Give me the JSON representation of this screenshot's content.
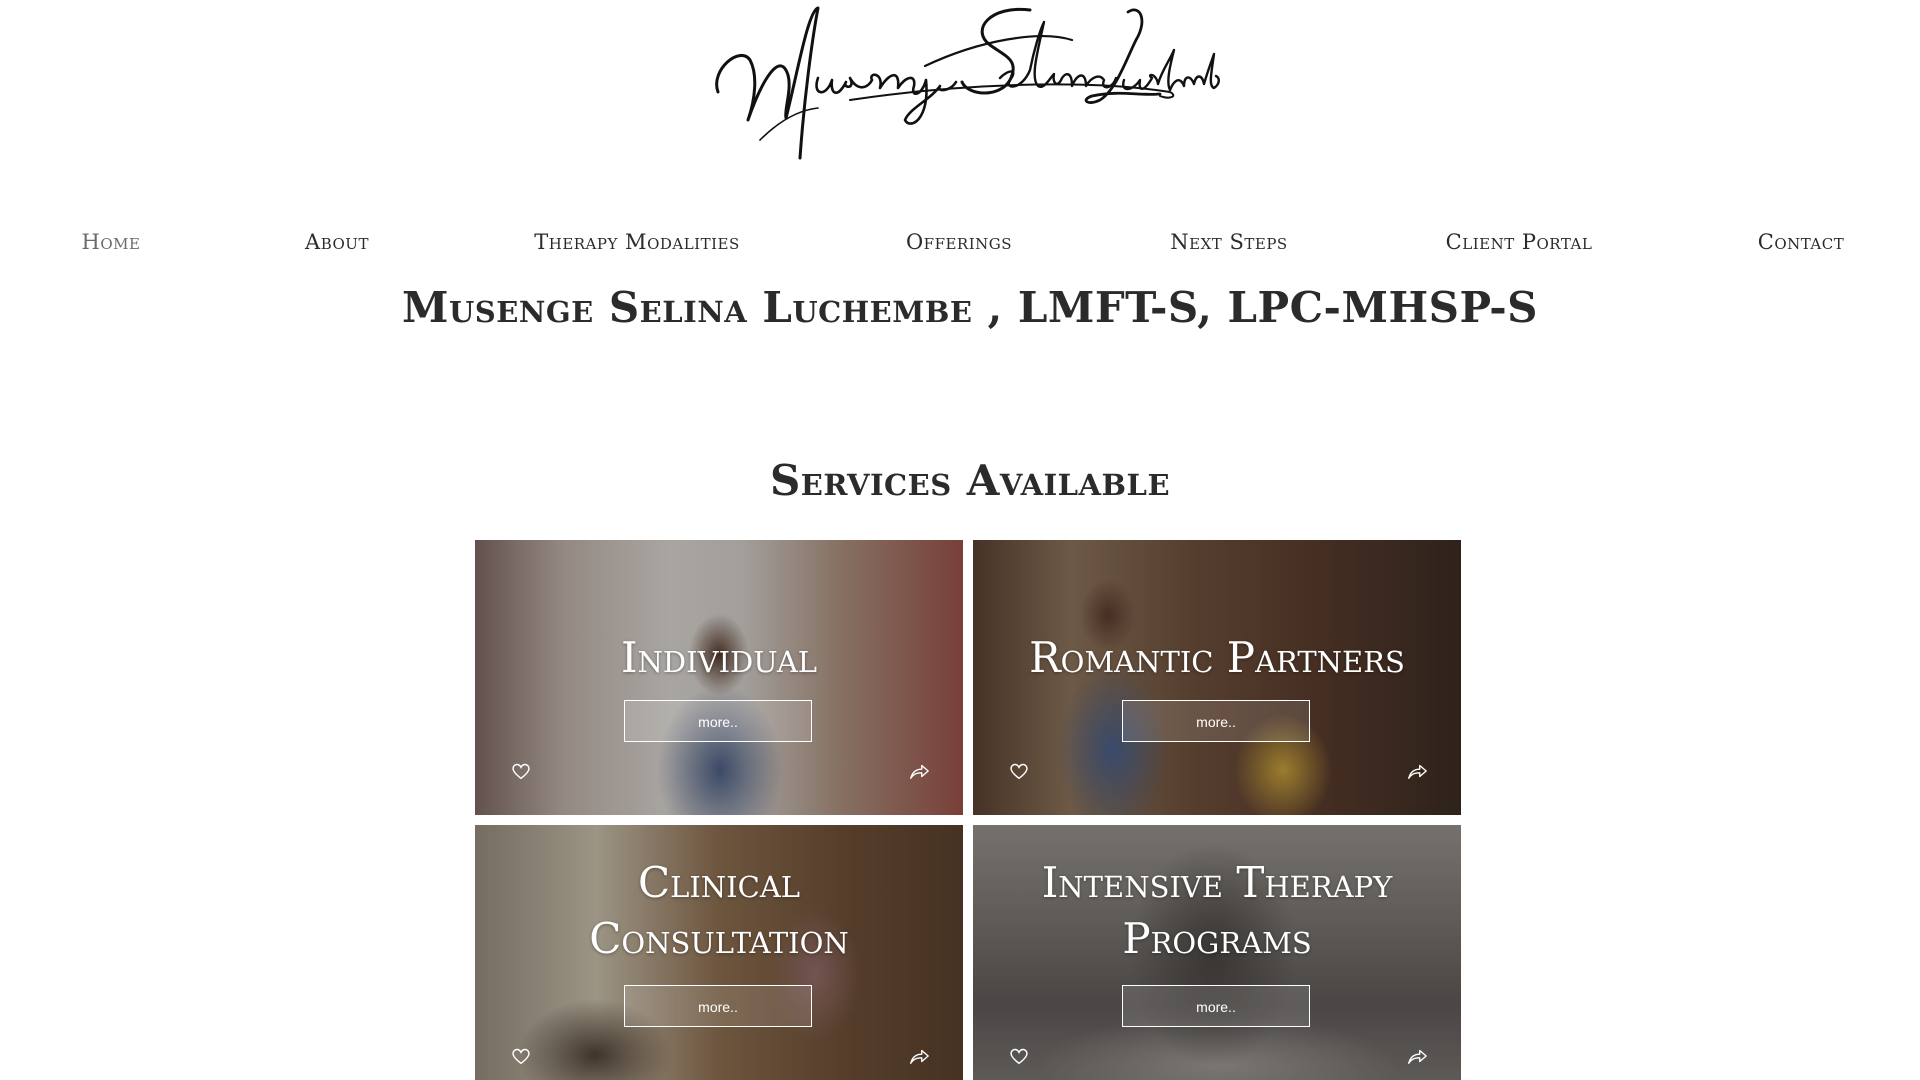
{
  "logo": {
    "signature_text": "Musenge Selina Luchembe"
  },
  "nav": {
    "items": [
      {
        "label": "Home"
      },
      {
        "label": "About"
      },
      {
        "label": "Therapy Modalities"
      },
      {
        "label": "Offerings"
      },
      {
        "label": "Next Steps"
      },
      {
        "label": "Client Portal"
      },
      {
        "label": "Contact"
      }
    ],
    "active_color": "#6b6b6b"
  },
  "page_title": "Musenge Selina Luchembe , LMFT-S, LPC-MHSP-S",
  "services": {
    "title": "Services Available",
    "cards": [
      {
        "title_line1": "Individual",
        "title_line2": "",
        "button": "more..",
        "like_icon": "heart-icon",
        "share_icon": "share-arrow-icon"
      },
      {
        "title_line1": "Romantic Partners",
        "title_line2": "",
        "button": "more..",
        "like_icon": "heart-icon",
        "share_icon": "share-arrow-icon"
      },
      {
        "title_line1": "Clinical",
        "title_line2": "Consultation",
        "button": "more..",
        "like_icon": "heart-icon",
        "share_icon": "share-arrow-icon"
      },
      {
        "title_line1": "Intensive Therapy",
        "title_line2": "Programs",
        "button": "more..",
        "like_icon": "heart-icon",
        "share_icon": "share-arrow-icon"
      }
    ]
  },
  "colors": {
    "text": "#2b2b2b",
    "card_text": "#ffffff"
  }
}
